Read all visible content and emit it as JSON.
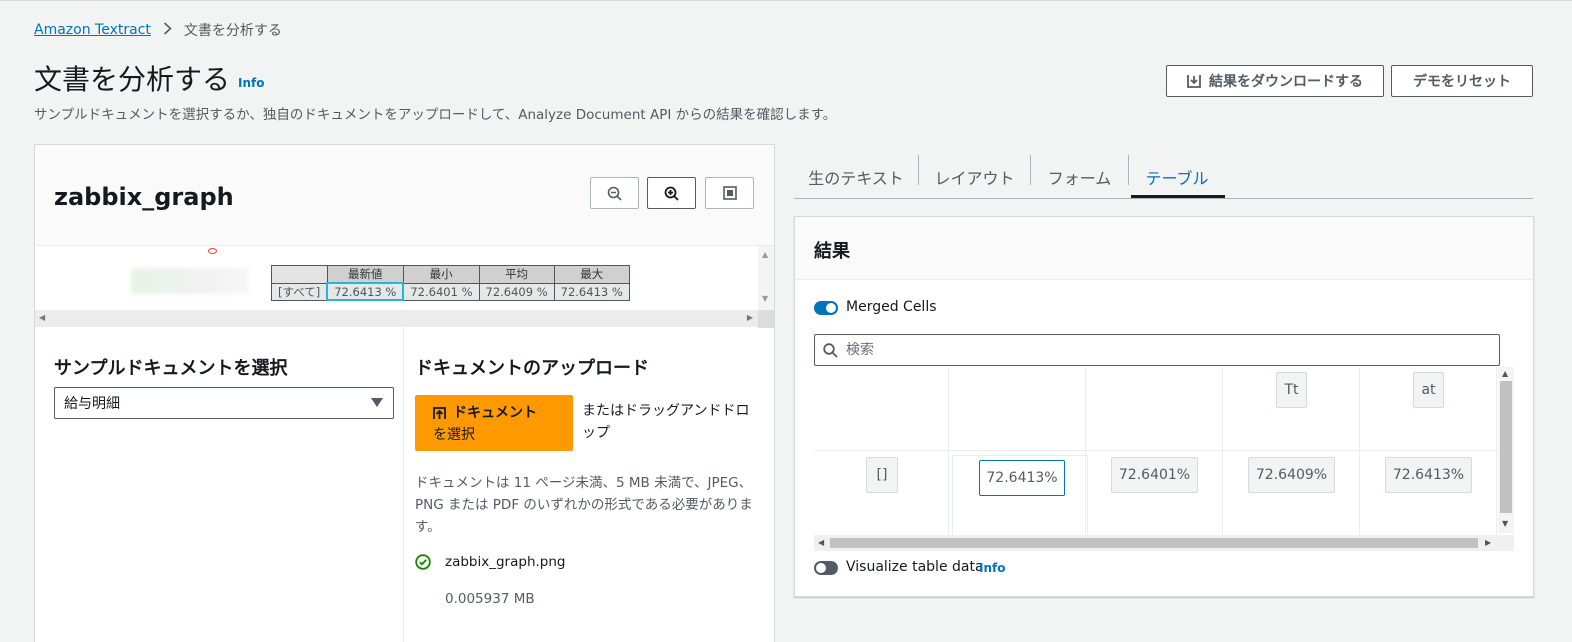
{
  "breadcrumb": {
    "root": "Amazon Textract",
    "current": "文書を分析する"
  },
  "header": {
    "title": "文書を分析する",
    "info": "Info",
    "subtitle": "サンプルドキュメントを選択するか、独自のドキュメントをアップロードして、Analyze Document API からの結果を確認します。",
    "download_label": "結果をダウンロードする",
    "reset_label": "デモをリセット"
  },
  "document": {
    "name": "zabbix_graph",
    "preview_table": {
      "headers": [
        "",
        "最新値",
        "最小",
        "平均",
        "最大"
      ],
      "row": [
        "[すべて]",
        "72.6413 %",
        "72.6401 %",
        "72.6409 %",
        "72.6413 %"
      ]
    }
  },
  "sample": {
    "label": "サンプルドキュメントを選択",
    "selected": "給与明細"
  },
  "upload": {
    "label": "ドキュメントのアップロード",
    "button_line1": "ドキュメント",
    "button_line2": "を選択",
    "drag_text": "またはドラッグアンドドロップ",
    "constraint": "ドキュメントは 11 ページ未満、5 MB 未満で、JPEG、PNG または PDF のいずれかの形式である必要があります。",
    "file_name": "zabbix_graph.png",
    "file_size": "0.005937 MB"
  },
  "tabs": [
    {
      "label": "生のテキスト"
    },
    {
      "label": "レイアウト"
    },
    {
      "label": "フォーム"
    },
    {
      "label": "テーブル"
    }
  ],
  "results": {
    "title": "結果",
    "merged_cells_label": "Merged Cells",
    "search_placeholder": "検索",
    "header_chips": [
      "Tt",
      "at"
    ],
    "row_cells": [
      "[]",
      "72.6413%",
      "72.6401%",
      "72.6409%",
      "72.6413%"
    ],
    "visualize_label": "Visualize table data",
    "visualize_info": "Info"
  },
  "colors": {
    "accent": "#0073bb",
    "primary_button": "#ff9900",
    "background": "#f2f3f3"
  }
}
